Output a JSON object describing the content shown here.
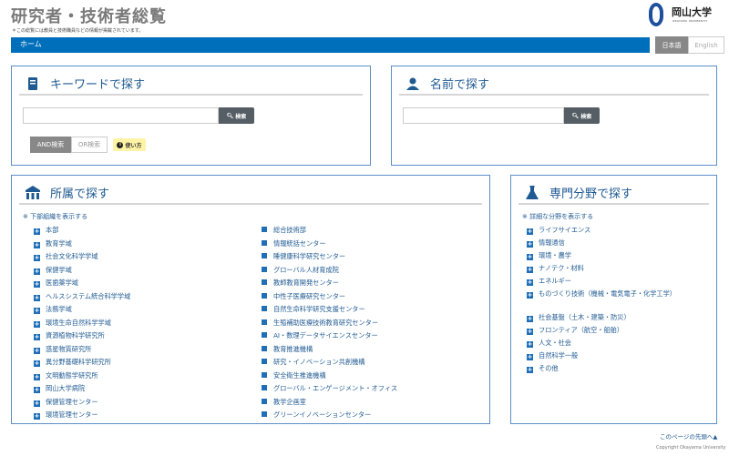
{
  "header": {
    "title": "研究者・技術者総覧",
    "note": "＊この総覧には教員と技術職員などの情報が掲載されています。",
    "logo_jp": "岡山大学",
    "logo_en": "OKAYAMA UNIVERSITY"
  },
  "nav": {
    "home": "ホーム"
  },
  "lang": {
    "ja": "日本語",
    "en": "English"
  },
  "keyword": {
    "title": "キーワードで探す",
    "search_label": "検索",
    "mode_and": "AND検索",
    "mode_or": "OR検索",
    "help": "使い方"
  },
  "name": {
    "title": "名前で探す",
    "search_label": "検索"
  },
  "affiliation": {
    "title": "所属で探す",
    "toggle": "※ 下部組織を表示する",
    "left": [
      "本部",
      "教育学域",
      "社会文化科学学域",
      "保健学域",
      "医歯薬学域",
      "ヘルスシステム統合科学学域",
      "法務学域",
      "環境生命自然科学学域",
      "資源植物科学研究所",
      "惑星物質研究所",
      "異分野基礎科学研究所",
      "文明動態学研究所",
      "岡山大学病院",
      "保健管理センター",
      "環境管理センター"
    ],
    "right": [
      "総合技術部",
      "情報統括センター",
      "睡健康科学研究センター",
      "グローバル人材育成院",
      "教師教育開発センター",
      "中性子医療研究センター",
      "自然生命科学研究支援センター",
      "生殖補助医療技術教育研究センター",
      "AI・数理データサイエンスセンター",
      "教育推進機構",
      "研究・イノベーション共創機構",
      "安全衛生推進機構",
      "グローバル・エンゲージメント・オフィス",
      "教学企画室",
      "グリーンイノベーションセンター"
    ]
  },
  "field": {
    "title": "専門分野で探す",
    "toggle": "※ 詳細な分野を表示する",
    "items": [
      "ライフサイエンス",
      "情報通信",
      "環境・農学",
      "ナノテク・材料",
      "エネルギー",
      "ものづくり技術（機械・電気電子・化学工学）",
      "社会基盤（土木・建築・防災）",
      "フロンティア（航空・船舶）",
      "人文・社会",
      "自然科学一般",
      "その他"
    ]
  },
  "footer": {
    "pagetop": "このページの先頭へ▲",
    "copyright": "Copyright Okayama University"
  }
}
